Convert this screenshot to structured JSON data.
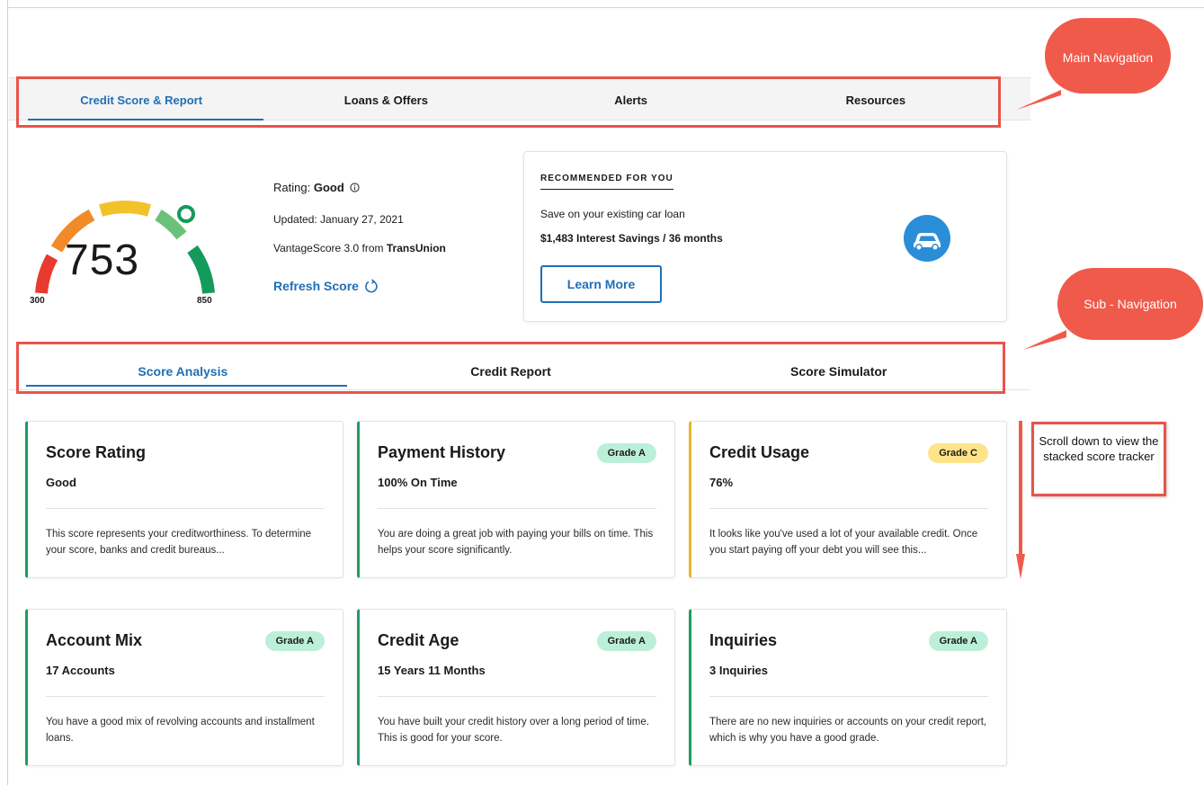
{
  "main_nav": {
    "tabs": [
      {
        "label": "Credit Score & Report",
        "active": true
      },
      {
        "label": "Loans & Offers",
        "active": false
      },
      {
        "label": "Alerts",
        "active": false
      },
      {
        "label": "Resources",
        "active": false
      }
    ],
    "callout": "Main Navigation"
  },
  "score": {
    "value": "753",
    "min": "300",
    "max": "850",
    "rating_label": "Rating:",
    "rating_value": "Good",
    "updated": "Updated: January 27, 2021",
    "source_prefix": "VantageScore 3.0 from",
    "source_bureau": "TransUnion",
    "refresh_label": "Refresh Score"
  },
  "recommended": {
    "title": "RECOMMENDED FOR YOU",
    "line1": "Save on your existing car loan",
    "line2": "$1,483 Interest Savings / 36 months",
    "button": "Learn More",
    "icon": "car-icon"
  },
  "sub_nav": {
    "tabs": [
      {
        "label": "Score Analysis",
        "active": true
      },
      {
        "label": "Credit Report",
        "active": false
      },
      {
        "label": "Score Simulator",
        "active": false
      }
    ],
    "callout": "Sub - Navigation"
  },
  "cards": [
    {
      "title": "Score Rating",
      "value": "Good",
      "badge": "",
      "desc": "This score represents your creditworthiness. To determine your score, banks and credit bureaus...",
      "accent": "#1e9c63"
    },
    {
      "title": "Payment History",
      "value": "100% On Time",
      "badge": "Grade A",
      "desc": "You are doing a great job with paying your bills on time. This helps your score significantly.",
      "accent": "#1e9c63"
    },
    {
      "title": "Credit Usage",
      "value": "76%",
      "badge": "Grade C",
      "desc": "It looks like you've used a lot of your available credit. Once you start paying off your debt you will see this...",
      "accent": "#e8b72a"
    },
    {
      "title": "Account Mix",
      "value": "17 Accounts",
      "badge": "Grade A",
      "desc": "You have a good mix of revolving accounts and installment loans.",
      "accent": "#1e9c63"
    },
    {
      "title": "Credit Age",
      "value": "15 Years 11 Months",
      "badge": "Grade A",
      "desc": "You have built your credit history over a long period of time. This is good for your score.",
      "accent": "#1e9c63"
    },
    {
      "title": "Inquiries",
      "value": "3 Inquiries",
      "badge": "Grade A",
      "desc": "There are no new inquiries or accounts on your credit report, which is why you have a good grade.",
      "accent": "#1e9c63"
    }
  ],
  "scroll_note": "Scroll down to view the stacked score tracker",
  "colors": {
    "accent_blue": "#1f6fb5",
    "annotation_red": "#e8544a",
    "grade_a_bg": "#bcefd9",
    "grade_c_bg": "#ffe38a"
  }
}
